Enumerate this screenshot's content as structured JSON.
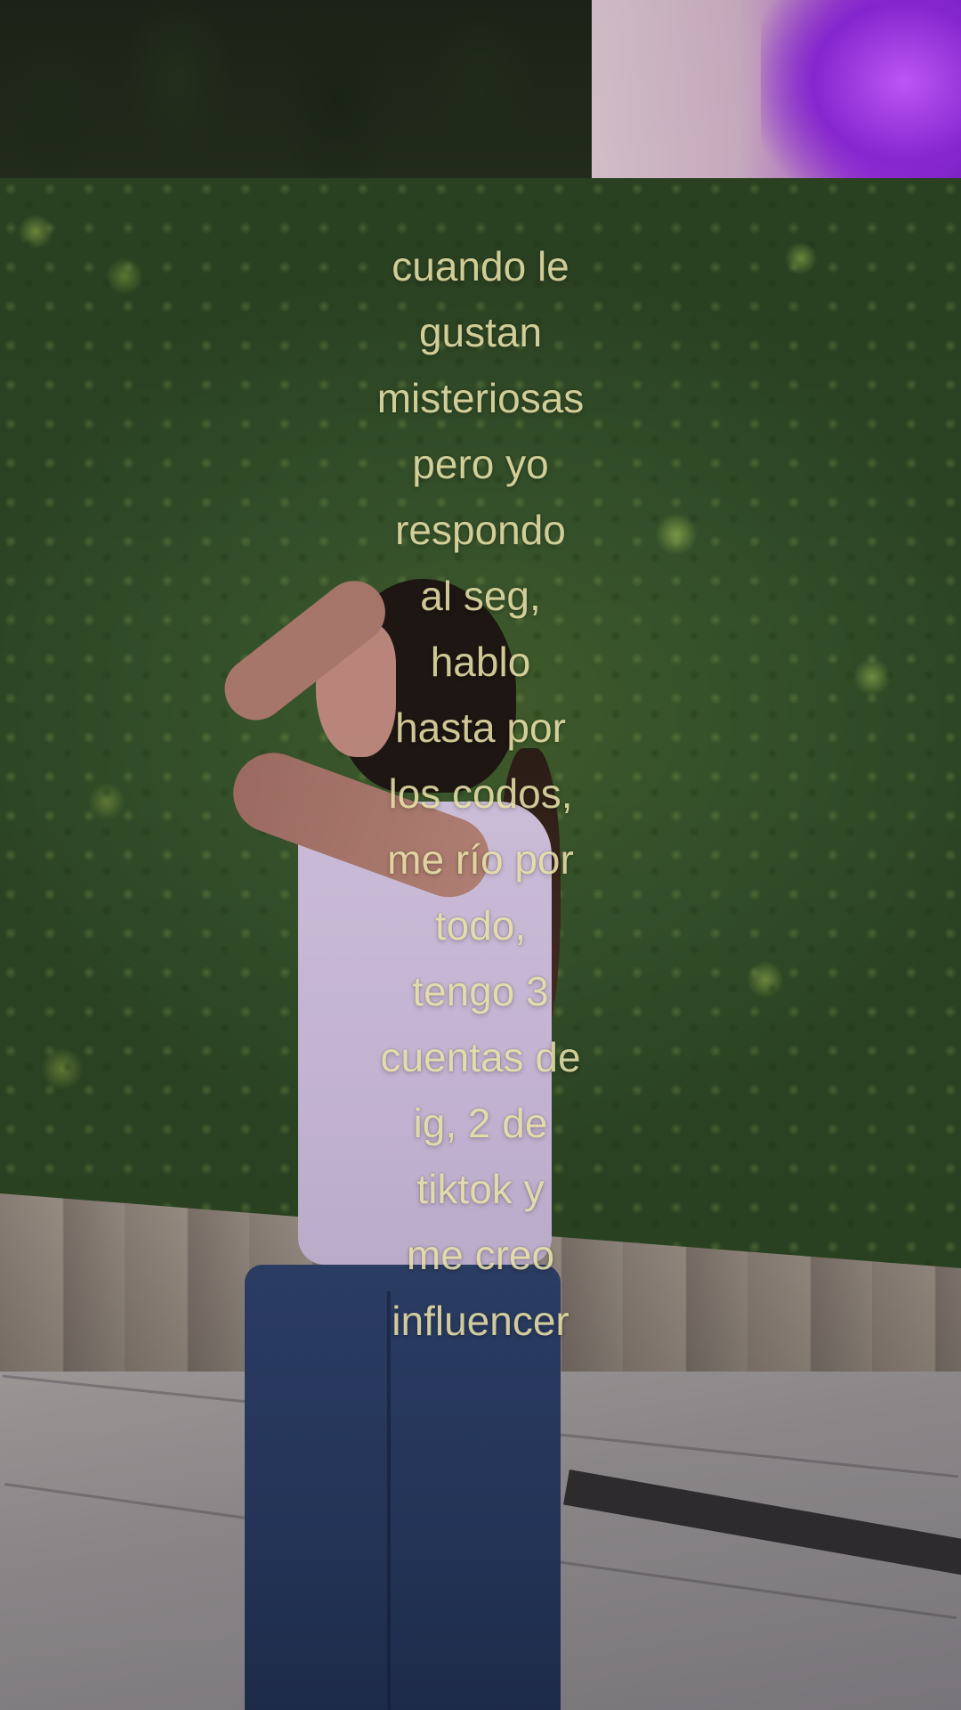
{
  "caption": {
    "lines": [
      "cuando le",
      "gustan",
      "misteriosas",
      "pero yo",
      "respondo",
      "al seg,",
      "hablo",
      "hasta por",
      "los codos,",
      "me río por",
      "todo,",
      "tengo 3",
      "cuentas de",
      "ig, 2 de",
      "tiktok y",
      "me creo",
      "influencer"
    ],
    "color": "#e8e0a8"
  },
  "scene": {
    "hedge_color": "#34502a",
    "wall_accent": "#a035d6",
    "shirt_color": "#c7b6d6",
    "jeans_color": "#25365b"
  }
}
